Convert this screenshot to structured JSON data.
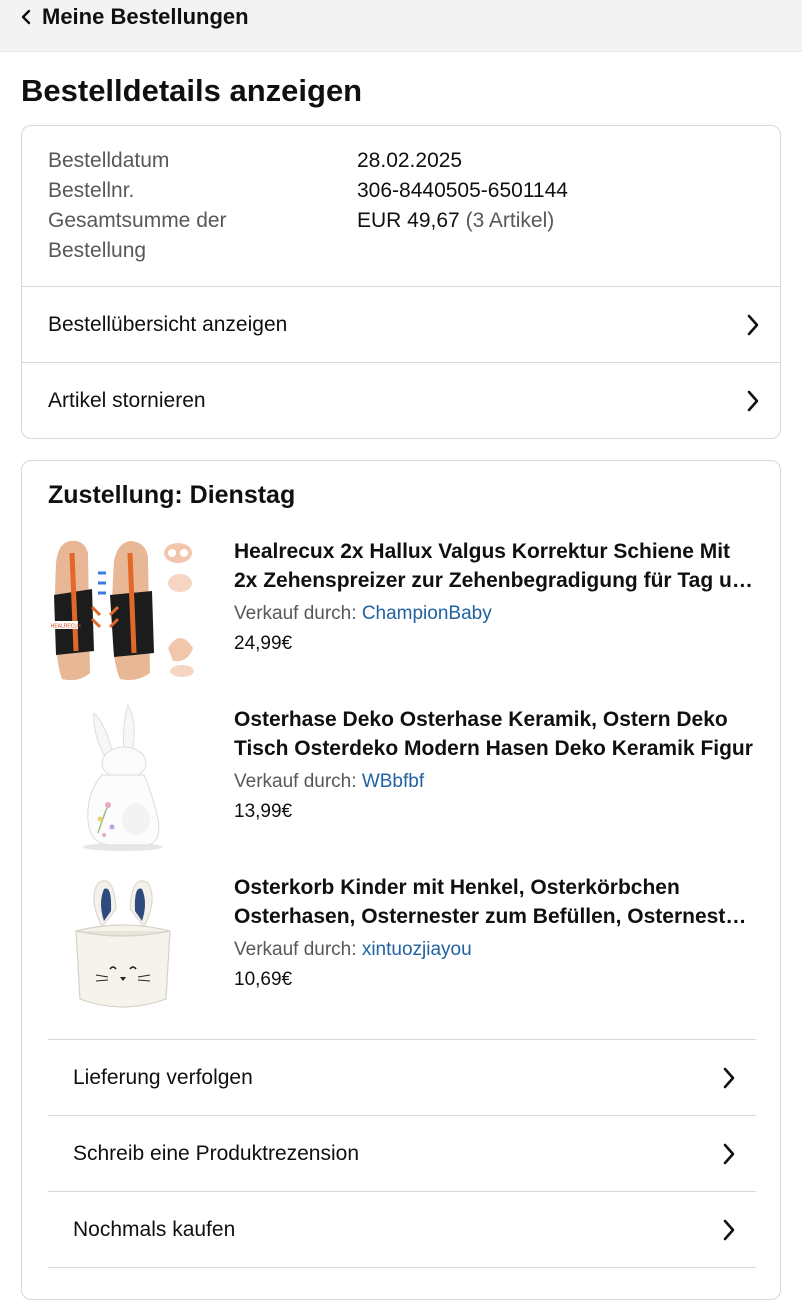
{
  "header": {
    "back_label": "Meine Bestellungen",
    "back_icon": "chevron-left-icon"
  },
  "page_title": "Bestelldetails anzeigen",
  "summary": {
    "date_label": "Bestelldatum",
    "date_value": "28.02.2025",
    "order_label": "Bestellnr.",
    "order_value": "306-8440505-6501144",
    "total_label_line1": "Gesamtsumme der",
    "total_label_line2": "Bestellung",
    "total_value": "EUR 49,67",
    "total_count": "(3 Artikel)"
  },
  "summary_links": [
    {
      "label": "Bestellübersicht anzeigen",
      "icon": "chevron-right-icon"
    },
    {
      "label": "Artikel stornieren",
      "icon": "chevron-right-icon"
    }
  ],
  "delivery": {
    "heading": "Zustellung: Dienstag",
    "items": [
      {
        "title": "Healrecux 2x Hallux Valgus Korrektur Schiene Mit 2x Zehenspreizer zur Zehenbegradigung für Tag und Nacht",
        "seller_prefix": "Verkauf durch:",
        "seller": "ChampionBaby",
        "price": "24,99€",
        "image": "hallux-splint-product-image",
        "image_text": "HEALRECUX"
      },
      {
        "title": "Osterhase Deko Osterhase Keramik, Ostern Deko Tisch Osterdeko Modern Hasen Deko Keramik Figur",
        "seller_prefix": "Verkauf durch:",
        "seller": "WBbfbf",
        "price": "13,99€",
        "image": "ceramic-bunny-product-image"
      },
      {
        "title": "Osterkorb Kinder mit Henkel, Osterkörbchen Osterhasen, Osternester zum Befüllen, Osternest Filz",
        "seller_prefix": "Verkauf durch:",
        "seller": "xintuozjiayou",
        "price": "10,69€",
        "image": "easter-basket-product-image"
      }
    ],
    "actions": [
      {
        "label": "Lieferung verfolgen",
        "icon": "chevron-right-icon"
      },
      {
        "label": "Schreib eine Produktrezension",
        "icon": "chevron-right-icon"
      },
      {
        "label": "Nochmals kaufen",
        "icon": "chevron-right-icon"
      }
    ]
  },
  "colors": {
    "link": "#2162a1",
    "muted": "#565959",
    "border": "#d5d9d9",
    "header_bg": "#f3f3f3"
  }
}
